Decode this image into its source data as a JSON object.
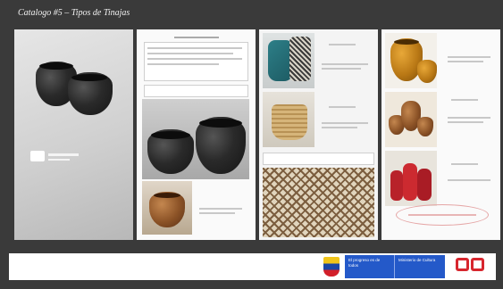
{
  "title": "Catalogo #5 – Tipos de Tinajas",
  "panels": [
    {
      "id": "cover"
    },
    {
      "id": "page-2"
    },
    {
      "id": "page-3"
    },
    {
      "id": "page-4"
    }
  ],
  "footer": {
    "link_text": "",
    "gov_left": "El progreso es de todos",
    "gov_right": "Ministerio de Cultura"
  },
  "colors": {
    "background": "#3a3a3a",
    "accent": "#2459c9",
    "brand_red": "#d7262e"
  }
}
